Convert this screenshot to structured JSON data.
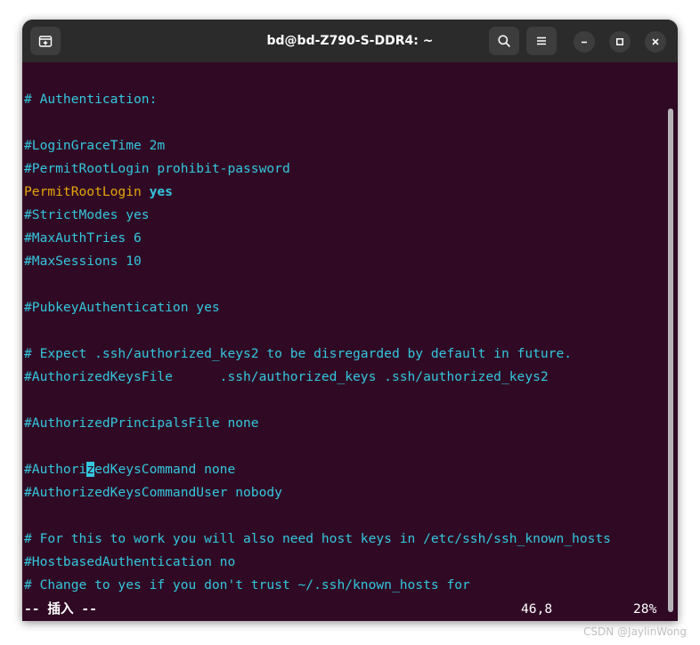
{
  "window": {
    "title": "bd@bd-Z790-S-DDR4: ~",
    "icons": {
      "new_tab": "new-tab-icon",
      "search": "search-icon",
      "menu": "hamburger-menu-icon",
      "minimize": "minimize-icon",
      "maximize": "maximize-icon",
      "close": "close-icon"
    }
  },
  "terminal": {
    "lines": {
      "l1": "# Authentication:",
      "l2": "#LoginGraceTime 2m",
      "l3": "#PermitRootLogin prohibit-password",
      "l4_key": "PermitRootLogin",
      "l4_value": "yes",
      "l5": "#StrictModes yes",
      "l6": "#MaxAuthTries 6",
      "l7": "#MaxSessions 10",
      "l8": "#PubkeyAuthentication yes",
      "l9": "# Expect .ssh/authorized_keys2 to be disregarded by default in future.",
      "l10": "#AuthorizedKeysFile      .ssh/authorized_keys .ssh/authorized_keys2",
      "l11": "#AuthorizedPrincipalsFile none",
      "l12_before": "#Authori",
      "l12_cursor": "z",
      "l12_after": "edKeysCommand none",
      "l13": "#AuthorizedKeysCommandUser nobody",
      "l14": "# For this to work you will also need host keys in /etc/ssh/ssh_known_hosts",
      "l15": "#HostbasedAuthentication no",
      "l16": "# Change to yes if you don't trust ~/.ssh/known_hosts for"
    },
    "status": {
      "mode": "-- 插入 --",
      "position": "46,8",
      "percent": "28%"
    },
    "colors": {
      "background": "#300a24",
      "comment": "#33c7de",
      "directive": "#e5a50a",
      "status_text": "#ffffff"
    }
  },
  "watermark": "CSDN @JaylinWong"
}
